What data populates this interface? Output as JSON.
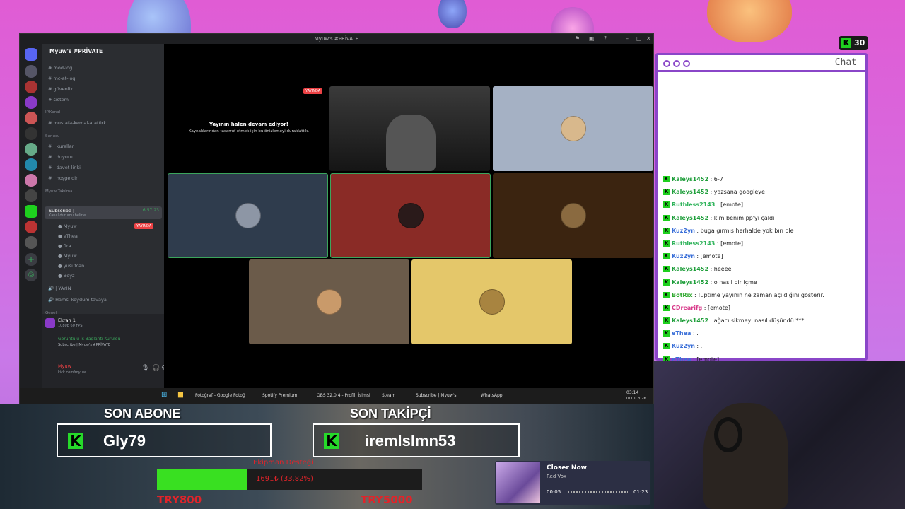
{
  "viewer_count": "30",
  "discord": {
    "window_title": "Myuw's #PRİVATE",
    "server_name": "Myuw's #PRİVATE",
    "channels_top": [
      "mod-log",
      "mc-at-log",
      "güvenlik",
      "sistem"
    ],
    "cat1": "İP.Kanal",
    "cat1_ch": "mustafa-kemal-atatürk",
    "cat2": "Sunucu",
    "cat2_ch": [
      "| kurallar",
      "| duyuru",
      "| davet-linki",
      "| hoşgeldin"
    ],
    "cat3": "Myuw Takılma",
    "active_vc": "Subscribe |",
    "active_vc_sub": "Kanal durumu belirle",
    "vc_time": "6:57:23",
    "live_badge": "YAYINDA",
    "members": [
      "Myuw",
      "eThea",
      "fira",
      "Myuw",
      "yusufcan",
      "Beyz"
    ],
    "ch_yayin": "| YAYIN",
    "ch_hamsi": "Hamsi koydum tavaya",
    "cat4": "Genel",
    "screen_label": "Ekran 1",
    "screen_sub": "1080p 60 FPS",
    "conn_status": "Görüntülü İş Bağlantı Kuruldu",
    "conn_sub": "Subscribe | Myuw's #PRİVATE",
    "user_name": "Myuw",
    "user_status": "kick.com/myuw",
    "stream_paused_title": "Yayının halen devam ediyor!",
    "stream_paused_sub": "Kaynaklarından tasarruf etmek için bu önizlemeyi duraklattık.",
    "tile_live": "YAYINDA"
  },
  "taskbar": {
    "apps": [
      "Fotoğraf - Google Fotoğ",
      "Spotify Premium",
      "OBS 32.0.4 - Profil: İsimsi",
      "Steam",
      "Subscribe | Myuw's",
      "WhatsApp"
    ],
    "time": "03:14",
    "date": "10.01.2026"
  },
  "chat": {
    "title": "Chat",
    "messages": [
      {
        "user": "Kaleys1452",
        "text": "6-7",
        "color": "#1e9e3a"
      },
      {
        "user": "Kaleys1452",
        "text": "yazsana googleye",
        "color": "#1e9e3a"
      },
      {
        "user": "Ruthless2143",
        "text": "[emote]",
        "color": "#2eb35a"
      },
      {
        "user": "Kaleys1452",
        "text": "kim benim pp'yi çaldı",
        "color": "#1e9e3a"
      },
      {
        "user": "Kuz2yn",
        "text": "buga gırmıs herhalde yok bırı ole",
        "color": "#3a6fd8"
      },
      {
        "user": "Ruthless2143",
        "text": "[emote]",
        "color": "#2eb35a"
      },
      {
        "user": "Kuz2yn",
        "text": "[emote]",
        "color": "#3a6fd8"
      },
      {
        "user": "Kaleys1452",
        "text": "heeee",
        "color": "#1e9e3a"
      },
      {
        "user": "Kaleys1452",
        "text": "o nasıl bir içme",
        "color": "#1e9e3a"
      },
      {
        "user": "BotRix",
        "text": "!uptime yayının ne zaman açıldığını gösterir.",
        "color": "#2ea82e"
      },
      {
        "user": "CDrearifg",
        "text": "[emote]",
        "color": "#d83a8a"
      },
      {
        "user": "Kaleys1452",
        "text": "ağacı sikmeyi nasıl düşündü ***",
        "color": "#1e9e3a"
      },
      {
        "user": "eThea",
        "text": ".",
        "color": "#3a6fd8"
      },
      {
        "user": "Kuz2yn",
        "text": ".",
        "color": "#3a6fd8"
      },
      {
        "user": "eThea",
        "text": "[emote]",
        "color": "#3a6fd8"
      }
    ]
  },
  "overlay": {
    "last_sub_label": "SON ABONE",
    "last_sub_name": "Gly79",
    "last_follow_label": "SON TAKİPÇİ",
    "last_follow_name": "iremlslmn53",
    "donation_title": "Ekipman Desteği",
    "donation_text": "1691₺ (33.82%)",
    "donation_progress": 0.3382,
    "donation_min": "TRY800",
    "donation_goal": "TRY5000",
    "song_title": "Closer Now",
    "song_artist": "Red Vox",
    "song_elapsed": "00:05",
    "song_total": "01:23"
  }
}
